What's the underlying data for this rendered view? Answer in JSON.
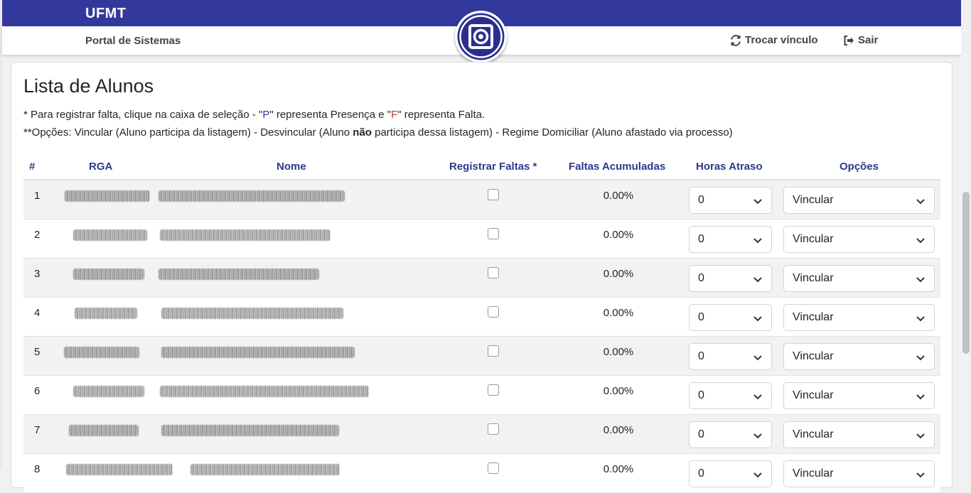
{
  "header": {
    "brand": "UFMT",
    "portal": "Portal de Sistemas",
    "switch_link": "Trocar vínculo",
    "logout_link": "Sair"
  },
  "page": {
    "title": "Lista de Alunos",
    "note1": {
      "a": "* Para registrar falta, clique na caixa de seleção - \"",
      "p": "P",
      "b": "\" representa Presença e \"",
      "f": "F",
      "c": "\" representa Falta."
    },
    "note2": {
      "a": "**Opções: Vincular (Aluno participa da listagem) - Desvincular (Aluno ",
      "bold": "não",
      "b": " participa dessa listagem) - Regime Domiciliar (Aluno afastado via processo)"
    }
  },
  "table": {
    "headers": [
      "#",
      "RGA",
      "Nome",
      "Registrar Faltas *",
      "Faltas Acumuladas",
      "Horas Atraso",
      "Opções"
    ],
    "rows": [
      {
        "num": "1",
        "faltas": "0.00%",
        "horas": "0",
        "opcao": "Vincular"
      },
      {
        "num": "2",
        "faltas": "0.00%",
        "horas": "0",
        "opcao": "Vincular"
      },
      {
        "num": "3",
        "faltas": "0.00%",
        "horas": "0",
        "opcao": "Vincular"
      },
      {
        "num": "4",
        "faltas": "0.00%",
        "horas": "0",
        "opcao": "Vincular"
      },
      {
        "num": "5",
        "faltas": "0.00%",
        "horas": "0",
        "opcao": "Vincular"
      },
      {
        "num": "6",
        "faltas": "0.00%",
        "horas": "0",
        "opcao": "Vincular"
      },
      {
        "num": "7",
        "faltas": "0.00%",
        "horas": "0",
        "opcao": "Vincular"
      },
      {
        "num": "8",
        "faltas": "0.00%",
        "horas": "0",
        "opcao": "Vincular"
      }
    ]
  },
  "colors": {
    "brand": "#33399c",
    "header_text": "#2d3a8c",
    "presenca": "#2b3aa8",
    "falta": "#c0392b"
  }
}
